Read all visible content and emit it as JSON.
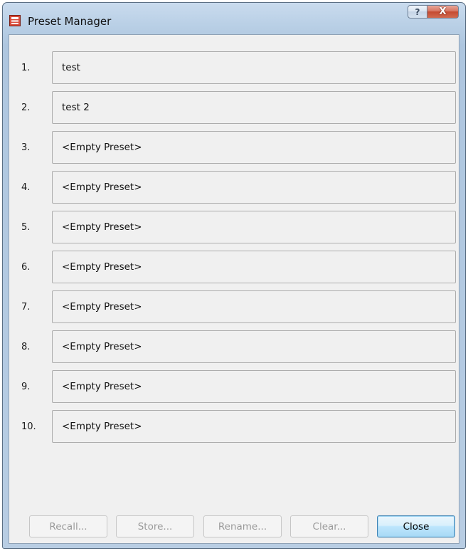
{
  "window": {
    "title": "Preset Manager",
    "help_glyph": "?",
    "close_glyph": "X",
    "icon": "preset-app-icon"
  },
  "presets": [
    {
      "number": "1.",
      "name": "test"
    },
    {
      "number": "2.",
      "name": "test 2"
    },
    {
      "number": "3.",
      "name": "<Empty Preset>"
    },
    {
      "number": "4.",
      "name": "<Empty Preset>"
    },
    {
      "number": "5.",
      "name": "<Empty Preset>"
    },
    {
      "number": "6.",
      "name": "<Empty Preset>"
    },
    {
      "number": "7.",
      "name": "<Empty Preset>"
    },
    {
      "number": "8.",
      "name": "<Empty Preset>"
    },
    {
      "number": "9.",
      "name": "<Empty Preset>"
    },
    {
      "number": "10.",
      "name": "<Empty Preset>"
    }
  ],
  "buttons": {
    "recall": "Recall...",
    "store": "Store...",
    "rename": "Rename...",
    "clear": "Clear...",
    "close": "Close"
  },
  "colors": {
    "accent_close": "#c44a31",
    "default_button_border": "#3c7fb1",
    "disabled_text": "#9a9a9a"
  }
}
